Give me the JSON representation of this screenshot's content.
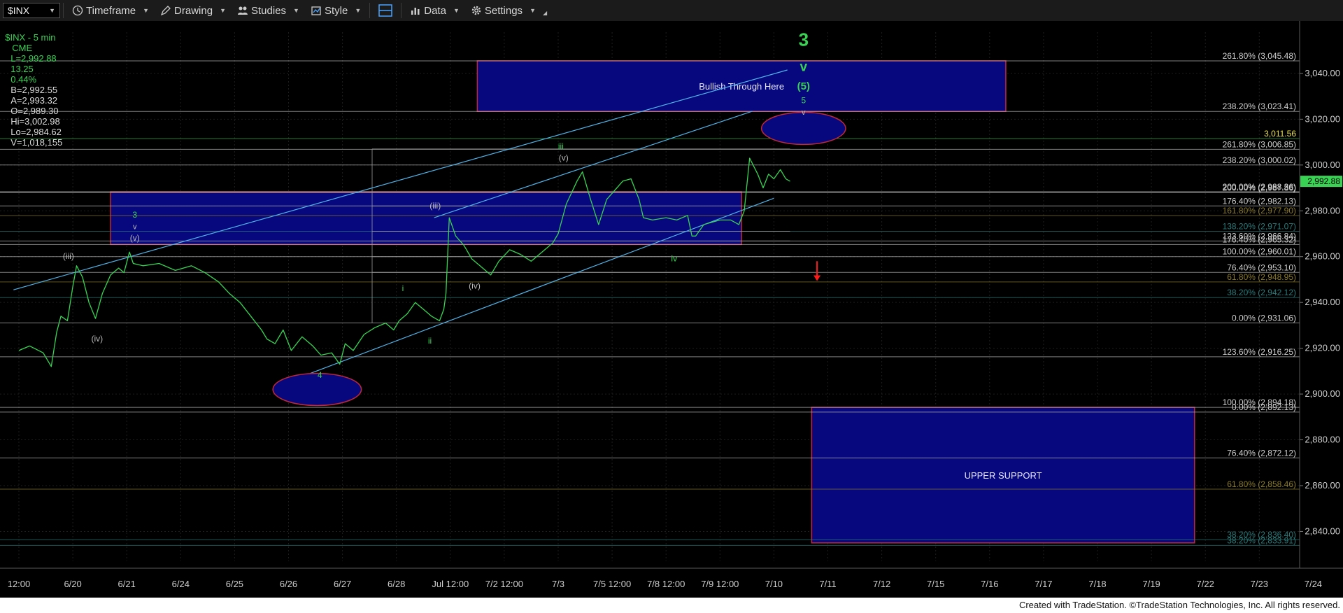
{
  "toolbar": {
    "symbol": "$INX",
    "timeframe": "Timeframe",
    "drawing": "Drawing",
    "studies": "Studies",
    "style": "Style",
    "data": "Data",
    "settings": "Settings"
  },
  "status": {
    "symbol": "$INX - 5 min",
    "exchange": "CME",
    "last": "L=2,992.88",
    "change": "13.25",
    "pct": "0.44%",
    "bid": "B=2,992.55",
    "ask": "A=2,993.32",
    "open": "O=2,989.30",
    "high": "Hi=3,002.98",
    "low": "Lo=2,984.62",
    "volume": "V=1,018,155"
  },
  "footer": "Created with TradeStation. ©TradeStation Technologies, Inc. All rights reserved.",
  "chart_data": {
    "type": "line",
    "title": "",
    "ylim": [
      2827,
      3058
    ],
    "grid": true,
    "last_price": "2,992.88",
    "y_ticks": [
      {
        "label": "3,040.00",
        "value": 3040
      },
      {
        "label": "3,020.00",
        "value": 3020
      },
      {
        "label": "3,000.00",
        "value": 3000
      },
      {
        "label": "2,980.00",
        "value": 2980
      },
      {
        "label": "2,960.00",
        "value": 2960
      },
      {
        "label": "2,940.00",
        "value": 2940
      },
      {
        "label": "2,920.00",
        "value": 2920
      },
      {
        "label": "2,900.00",
        "value": 2900
      },
      {
        "label": "2,880.00",
        "value": 2880
      },
      {
        "label": "2,860.00",
        "value": 2860
      },
      {
        "label": "2,840.00",
        "value": 2840
      }
    ],
    "x_ticks": [
      "12:00",
      "6/20",
      "6/21",
      "6/24",
      "6/25",
      "6/26",
      "6/27",
      "6/28",
      "Jul 12:00",
      "7/2 12:00",
      "7/3",
      "7/5 12:00",
      "7/8 12:00",
      "7/9 12:00",
      "7/10",
      "7/11",
      "7/12",
      "7/15",
      "7/16",
      "7/17",
      "7/18",
      "7/19",
      "7/22",
      "7/23",
      "7/24"
    ],
    "price_series": [
      [
        0,
        2919
      ],
      [
        0.2,
        2921
      ],
      [
        0.45,
        2918
      ],
      [
        0.6,
        2912
      ],
      [
        0.7,
        2927
      ],
      [
        0.78,
        2934
      ],
      [
        0.9,
        2932
      ],
      [
        1.0,
        2947
      ],
      [
        1.07,
        2956
      ],
      [
        1.18,
        2951
      ],
      [
        1.3,
        2940
      ],
      [
        1.42,
        2933
      ],
      [
        1.55,
        2944
      ],
      [
        1.7,
        2952
      ],
      [
        1.85,
        2955
      ],
      [
        1.95,
        2953
      ],
      [
        2.05,
        2962
      ],
      [
        2.12,
        2957
      ],
      [
        2.3,
        2956
      ],
      [
        2.6,
        2957
      ],
      [
        2.9,
        2954
      ],
      [
        3.2,
        2956
      ],
      [
        3.45,
        2953
      ],
      [
        3.7,
        2949
      ],
      [
        3.9,
        2944
      ],
      [
        4.1,
        2940
      ],
      [
        4.3,
        2934
      ],
      [
        4.5,
        2928
      ],
      [
        4.6,
        2924
      ],
      [
        4.75,
        2922
      ],
      [
        4.9,
        2928
      ],
      [
        5.05,
        2919
      ],
      [
        5.25,
        2925
      ],
      [
        5.45,
        2921
      ],
      [
        5.6,
        2917
      ],
      [
        5.8,
        2918
      ],
      [
        5.95,
        2913
      ],
      [
        6.05,
        2922
      ],
      [
        6.2,
        2919
      ],
      [
        6.4,
        2926
      ],
      [
        6.6,
        2929
      ],
      [
        6.8,
        2931
      ],
      [
        6.95,
        2928
      ],
      [
        7.05,
        2932
      ],
      [
        7.2,
        2935
      ],
      [
        7.35,
        2940
      ],
      [
        7.5,
        2937
      ],
      [
        7.65,
        2934
      ],
      [
        7.8,
        2932
      ],
      [
        7.88,
        2937
      ],
      [
        7.92,
        2944
      ],
      [
        7.98,
        2977
      ],
      [
        8.1,
        2969
      ],
      [
        8.25,
        2965
      ],
      [
        8.4,
        2959
      ],
      [
        8.6,
        2955
      ],
      [
        8.75,
        2952
      ],
      [
        8.9,
        2958
      ],
      [
        9.1,
        2963
      ],
      [
        9.3,
        2961
      ],
      [
        9.5,
        2958
      ],
      [
        9.7,
        2962
      ],
      [
        9.9,
        2966
      ],
      [
        10.0,
        2970
      ],
      [
        10.15,
        2983
      ],
      [
        10.35,
        2993
      ],
      [
        10.45,
        2997
      ],
      [
        10.6,
        2985
      ],
      [
        10.75,
        2974
      ],
      [
        10.9,
        2985
      ],
      [
        11.05,
        2989
      ],
      [
        11.2,
        2993
      ],
      [
        11.35,
        2994
      ],
      [
        11.5,
        2985
      ],
      [
        11.58,
        2977
      ],
      [
        11.75,
        2976
      ],
      [
        12.0,
        2977
      ],
      [
        12.2,
        2976
      ],
      [
        12.4,
        2978
      ],
      [
        12.48,
        2969
      ],
      [
        12.55,
        2969
      ],
      [
        12.7,
        2974
      ],
      [
        12.85,
        2975
      ],
      [
        13.0,
        2976
      ],
      [
        13.2,
        2976
      ],
      [
        13.35,
        2974
      ],
      [
        13.45,
        2980
      ],
      [
        13.55,
        3003
      ],
      [
        13.7,
        2996
      ],
      [
        13.8,
        2990
      ],
      [
        13.9,
        2996
      ],
      [
        14.0,
        2994
      ],
      [
        14.12,
        2998
      ],
      [
        14.22,
        2994
      ],
      [
        14.3,
        2992.9
      ]
    ],
    "fib_levels": [
      {
        "label": "261.80% (3,045.48)",
        "value": 3045.48,
        "color": "#b8b8b8"
      },
      {
        "label": "238.20% (3,023.41)",
        "value": 3023.41,
        "color": "#b8b8b8"
      },
      {
        "label": "261.80% (3,006.85)",
        "value": 3006.85,
        "color": "#b8b8b8"
      },
      {
        "label": "238.20% (3,000.02)",
        "value": 3000.02,
        "color": "#b8b8b8"
      },
      {
        "label": "200.00% (2,988.36)",
        "value": 2988.36,
        "color": "#b8b8b8"
      },
      {
        "label": "200.00% (2,987.86)",
        "value": 2987.86,
        "color": "#b8b8b8"
      },
      {
        "label": "176.40% (2,982.13)",
        "value": 2982.13,
        "color": "#b8b8b8"
      },
      {
        "label": "161.80% (2,977.90)",
        "value": 2977.9,
        "color": "#8a7a2a"
      },
      {
        "label": "138.20% (2,971.07)",
        "value": 2971.07,
        "color": "#2a7a7a"
      },
      {
        "label": "123.60% (2,966.84)",
        "value": 2966.84,
        "color": "#b8b8b8"
      },
      {
        "label": "176.40% (2,965.32)",
        "value": 2965.32,
        "color": "#b8b8b8"
      },
      {
        "label": "100.00% (2,960.01)",
        "value": 2960.01,
        "color": "#b8b8b8"
      },
      {
        "label": "76.40% (2,953.10)",
        "value": 2953.1,
        "color": "#b8b8b8"
      },
      {
        "label": "61.80% (2,948.95)",
        "value": 2948.95,
        "color": "#8a7a2a"
      },
      {
        "label": "38.20% (2,942.12)",
        "value": 2942.12,
        "color": "#2a7a7a"
      },
      {
        "label": "0.00% (2,931.06)",
        "value": 2931.06,
        "color": "#b8b8b8"
      },
      {
        "label": "123.60% (2,916.25)",
        "value": 2916.25,
        "color": "#b8b8b8"
      },
      {
        "label": "100.00% (2,894.18)",
        "value": 2894.18,
        "color": "#b8b8b8"
      },
      {
        "label": "0.00% (2,892.13)",
        "value": 2892.13,
        "color": "#b8b8b8"
      },
      {
        "label": "76.40% (2,872.12)",
        "value": 2872.12,
        "color": "#b8b8b8"
      },
      {
        "label": "61.80% (2,858.46)",
        "value": 2858.46,
        "color": "#8a7a2a"
      },
      {
        "label": "38.20% (2,836.40)",
        "value": 2836.4,
        "color": "#2a7a7a"
      },
      {
        "label": "38.20% (2,833.91)",
        "value": 2833.91,
        "color": "#2a7a7a"
      }
    ],
    "target_line": {
      "label": "3,011.56",
      "value": 3011.56,
      "color": "#39d353"
    },
    "zones": [
      {
        "label": "Bullish Through Here",
        "x0": 8.5,
        "x1": 18.3,
        "y0": 3023.4,
        "y1": 3045.5
      },
      {
        "label": "",
        "x0": 1.7,
        "x1": 13.4,
        "y0": 2965.3,
        "y1": 2988.3
      },
      {
        "label": "UPPER SUPPORT",
        "x0": 14.7,
        "x1": 21.8,
        "y0": 2835,
        "y1": 2894.2
      }
    ],
    "ellipses": [
      {
        "cx": 14.55,
        "cy": 3016,
        "rx": 0.78,
        "ry": 7
      },
      {
        "cx": 5.53,
        "cy": 2902,
        "rx": 0.82,
        "ry": 7
      }
    ],
    "wave_labels": [
      {
        "text": "3",
        "x": 14.55,
        "y": 3052,
        "color": "#39d353",
        "size": 26,
        "bold": true
      },
      {
        "text": "v",
        "x": 14.55,
        "y": 3041,
        "color": "#39d353",
        "size": 19,
        "bold": true
      },
      {
        "text": "(5)",
        "x": 14.55,
        "y": 3033,
        "color": "#39d353",
        "size": 15,
        "bold": true
      },
      {
        "text": "5",
        "x": 14.55,
        "y": 3027,
        "color": "#39d353",
        "size": 12
      },
      {
        "text": "v",
        "x": 14.55,
        "y": 3022,
        "color": "#bbbbbb",
        "size": 11
      },
      {
        "text": "3",
        "x": 2.15,
        "y": 2977,
        "color": "#39d353",
        "size": 12
      },
      {
        "text": "v",
        "x": 2.15,
        "y": 2972,
        "color": "#bbbbbb",
        "size": 11
      },
      {
        "text": "(v)",
        "x": 2.15,
        "y": 2967,
        "color": "#bbbbbb",
        "size": 12
      },
      {
        "text": "(iii)",
        "x": 0.92,
        "y": 2959,
        "color": "#bbbbbb",
        "size": 12
      },
      {
        "text": "(iv)",
        "x": 1.45,
        "y": 2923,
        "color": "#bbbbbb",
        "size": 12
      },
      {
        "text": "4",
        "x": 5.58,
        "y": 2907,
        "color": "#39d353",
        "size": 12
      },
      {
        "text": "i",
        "x": 7.12,
        "y": 2945,
        "color": "#39d353",
        "size": 12
      },
      {
        "text": "ii",
        "x": 7.62,
        "y": 2922,
        "color": "#39d353",
        "size": 12
      },
      {
        "text": "(iii)",
        "x": 7.72,
        "y": 2981,
        "color": "#bbbbbb",
        "size": 12
      },
      {
        "text": "(iv)",
        "x": 8.45,
        "y": 2946,
        "color": "#bbbbbb",
        "size": 12
      },
      {
        "text": "iii",
        "x": 10.05,
        "y": 3007,
        "color": "#39d353",
        "size": 12
      },
      {
        "text": "(v)",
        "x": 10.1,
        "y": 3002,
        "color": "#bbbbbb",
        "size": 12
      },
      {
        "text": "iv",
        "x": 12.15,
        "y": 2958,
        "color": "#39d353",
        "size": 12
      }
    ],
    "trend_lines": [
      {
        "x0": -0.1,
        "y0": 2945.5,
        "x1": 14.25,
        "y1": 3041.5
      },
      {
        "x0": 5.4,
        "y0": 2909,
        "x1": 14.0,
        "y1": 2985.5
      },
      {
        "x0": 7.7,
        "y0": 2977,
        "x1": 13.6,
        "y1": 3023.5
      }
    ],
    "aux_lines": [
      {
        "x0": 6.55,
        "y0": 2931,
        "x1": 6.55,
        "y1": 3007,
        "color": "#9a9a9a"
      },
      {
        "x0": 6.55,
        "y0": 3007,
        "x1": 14.3,
        "y1": 3007,
        "color": "#9a9a9a"
      },
      {
        "x0": 6.55,
        "y0": 2982.1,
        "x1": 8.5,
        "y1": 2982.1,
        "color": "#9a9a9a"
      },
      {
        "x0": 6.55,
        "y0": 2953.1,
        "x1": 14.3,
        "y1": 2953.1,
        "color": "#9a9a9a"
      },
      {
        "x0": 6.55,
        "y0": 2971.07,
        "x1": 14.3,
        "y1": 2971.07,
        "color": "#9a9a9a"
      },
      {
        "x0": 6.55,
        "y0": 2966.84,
        "x1": 14.3,
        "y1": 2966.84,
        "color": "#9a9a9a"
      },
      {
        "x0": 6.55,
        "y0": 2960.01,
        "x1": 14.3,
        "y1": 2960.01,
        "color": "#9a9a9a"
      }
    ],
    "arrow": {
      "x": 14.8,
      "y0": 2958,
      "y1": 2950,
      "color": "#ff1a1a"
    }
  }
}
